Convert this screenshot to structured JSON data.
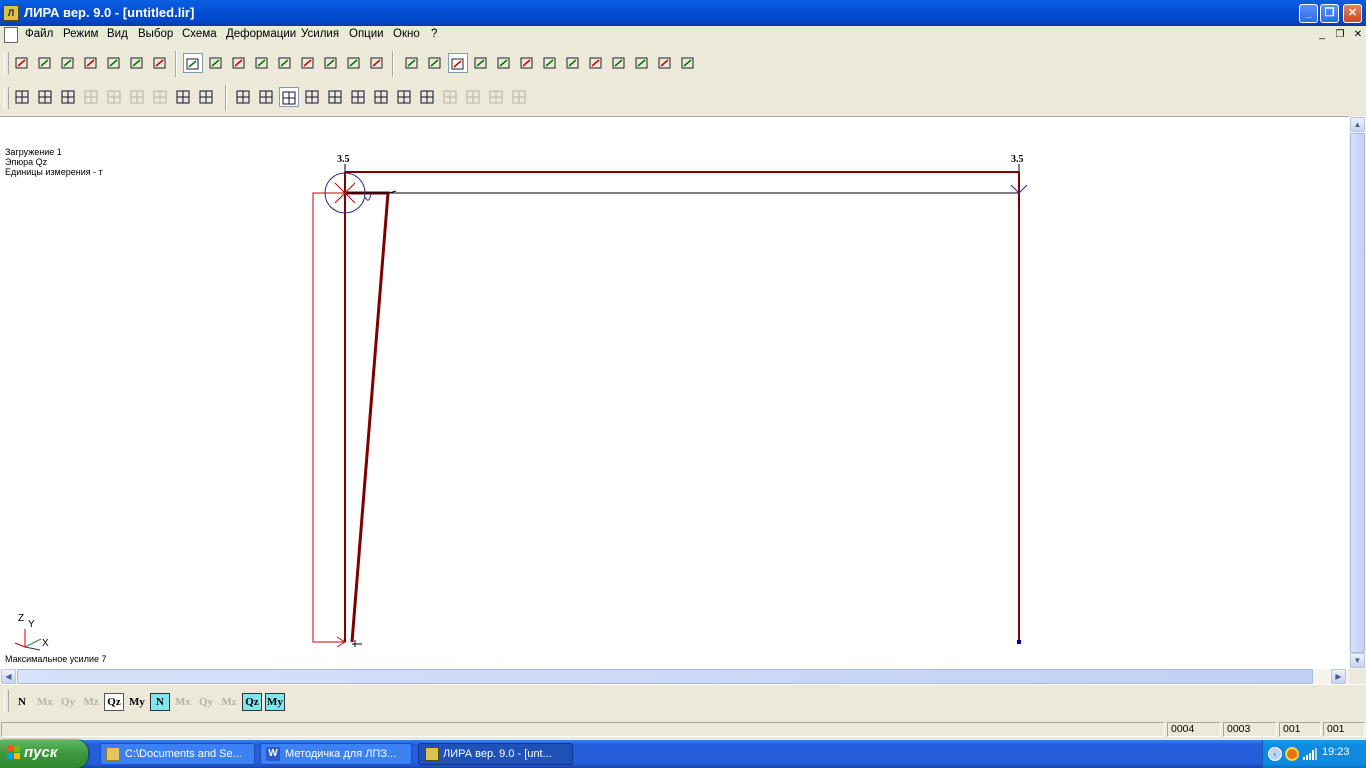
{
  "window": {
    "title": "ЛИРА  вер. 9.0 - [untitled.lir]",
    "app_icon_letter": "Л",
    "controls": {
      "minimize": "_",
      "restore": "❐",
      "close": "✕"
    }
  },
  "menu": {
    "items": [
      "Файл",
      "Режим",
      "Вид",
      "Выбор",
      "Схема",
      "Деформации",
      "Усилия",
      "Опции",
      "Окно",
      "?"
    ],
    "mdi_controls": {
      "minimize": "_",
      "restore": "❐",
      "close": "✕"
    }
  },
  "toolbar1": {
    "icons": [
      "copy-icon",
      "paste-icon",
      "dump-icon",
      "lightning-icon",
      "load-triangle-icon",
      "sigma-z-icon",
      "sigma-n-icon",
      "axes-icon",
      "xz-plane-icon",
      "xy-plane-icon",
      "yz-plane-icon",
      "rotate-icon",
      "flag-icon",
      "pencil-icon",
      "zoom-icon",
      "zoom-fit-icon",
      "filter-icon",
      "node-select-icon",
      "zoom-in-icon",
      "zoom-out-icon",
      "zoom-window-icon",
      "brush-icon",
      "eraser-icon",
      "layers-icon",
      "notes-icon",
      "palette-icon",
      "plate-icon",
      "3d-icon",
      "help-cursor-icon"
    ]
  },
  "toolbar2": {
    "icons": [
      "grid-frame-icon",
      "grid-frame2-icon",
      "grid-frame3-icon",
      "arc-icon",
      "ellipse-icon",
      "slash-icon",
      "double-slash-icon",
      "ruler-icon",
      "leaf-icon",
      "mesh-icon",
      "fill-icon",
      "arch-icon",
      "quad-icon",
      "quad2-icon",
      "node-n-icon",
      "node-n2-icon",
      "num-icon",
      "page-icon",
      "bar-chart-icon",
      "circle-p-icon",
      "weight-icon",
      "ky-icon"
    ]
  },
  "canvas": {
    "info_lines": [
      "Загружение  1",
      "Эпюра Qz",
      "Единицы измерения - т"
    ],
    "max_force_label": "Максимальное усилие  7",
    "axes": {
      "z": "Z",
      "y": "Y",
      "x": "X"
    },
    "value_left": "3.5",
    "value_right": "3.5",
    "colors": {
      "frame": "#800000",
      "diagram": "#cc0000",
      "line": "#000000"
    }
  },
  "force_bar": {
    "buttons": [
      {
        "label": "N",
        "name": "force-N-button",
        "state": "normal"
      },
      {
        "label": "Mx",
        "name": "force-Mx-button",
        "state": "disabled"
      },
      {
        "label": "Qy",
        "name": "force-Qy-button",
        "state": "disabled"
      },
      {
        "label": "Mz",
        "name": "force-Mz-button",
        "state": "disabled"
      },
      {
        "label": "Qz",
        "name": "force-Qz-button",
        "state": "active"
      },
      {
        "label": "My",
        "name": "force-My-button",
        "state": "normal"
      },
      {
        "label": "N",
        "name": "mosaic-N-button",
        "state": "cyan"
      },
      {
        "label": "Mx",
        "name": "mosaic-Mx-button",
        "state": "disabled"
      },
      {
        "label": "Qy",
        "name": "mosaic-Qy-button",
        "state": "disabled"
      },
      {
        "label": "Mz",
        "name": "mosaic-Mz-button",
        "state": "disabled"
      },
      {
        "label": "Qz",
        "name": "mosaic-Qz-button",
        "state": "cyan"
      },
      {
        "label": "My",
        "name": "mosaic-My-button",
        "state": "cyan"
      }
    ]
  },
  "status": {
    "cells": [
      "0004",
      "0003",
      "001",
      "001"
    ]
  },
  "taskbar": {
    "start_label": "пуск",
    "tasks": [
      {
        "label": "C:\\Documents and Se...",
        "icon": "folder-icon"
      },
      {
        "label": "Методичка для ЛПЗ...",
        "icon": "word-icon"
      },
      {
        "label": "ЛИРА  вер. 9.0 - [unt...",
        "icon": "lira-icon"
      }
    ],
    "clock": "19:23"
  }
}
